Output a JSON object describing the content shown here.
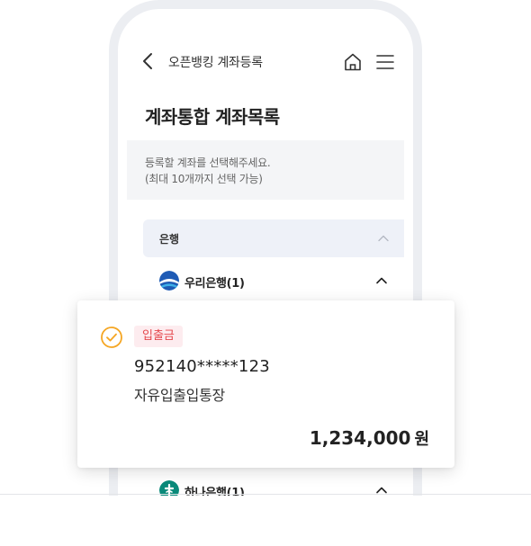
{
  "appbar": {
    "title": "오픈뱅킹 계좌등록"
  },
  "page": {
    "title": "계좌통합 계좌목록",
    "guide_lines": [
      "등록할 계좌를 선택해주세요.",
      "(최대 10개까지 선택 가능)"
    ]
  },
  "section": {
    "label": "은행"
  },
  "banks": [
    {
      "name": "우리은행(1)",
      "icon": "woori-bank-logo",
      "expanded": true
    },
    {
      "name": "하나은행(1)",
      "icon": "hana-bank-logo",
      "expanded": true
    }
  ],
  "account": {
    "selected": true,
    "type_badge": "입출금",
    "number": "952140*****123",
    "name": "자유입출입통장",
    "balance": "1,234,000",
    "unit": "원"
  },
  "colors": {
    "accent_check": "#f5a623",
    "badge_bg": "#fdecef",
    "badge_text": "#e5484d",
    "section_bg": "#eef1f8",
    "woori_blue": "#1e5bb5",
    "hana_green": "#0a8a7a"
  }
}
